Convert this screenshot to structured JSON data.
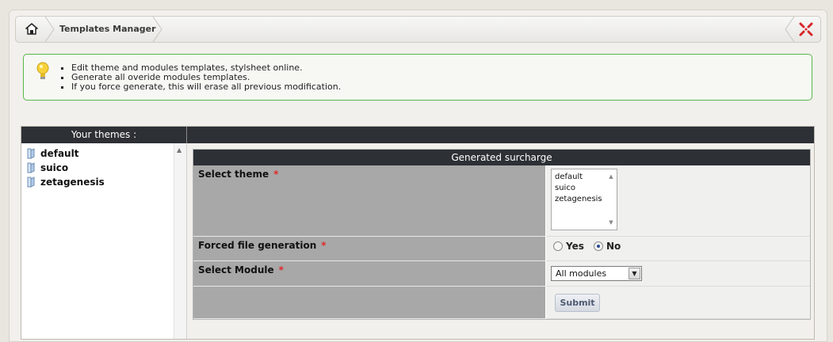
{
  "breadcrumb": {
    "title": "Templates Manager",
    "home_icon": "home-icon",
    "close_icon": "close-icon"
  },
  "tips": {
    "icon": "lightbulb-icon",
    "items": [
      "Edit theme and modules templates, stylsheet online.",
      "Generate all overide modules templates.",
      "If you force generate, this will erase all previous modification."
    ],
    "border_color": "#58b84a"
  },
  "themes_panel": {
    "header": "Your themes :",
    "items": [
      "default",
      "suico",
      "zetagenesis"
    ]
  },
  "form": {
    "title": "Generated surcharge",
    "select_theme_label": "Select theme",
    "theme_options": [
      "default",
      "suico",
      "zetagenesis"
    ],
    "forced_label": "Forced file generation",
    "yes_label": "Yes",
    "no_label": "No",
    "forced_selected": "No",
    "module_label": "Select Module",
    "module_value": "All modules",
    "required_mark": "*",
    "submit_label": "Submit"
  },
  "colors": {
    "header_dark": "#2d3035",
    "label_bg": "#a8a8a8",
    "required": "#e0282c"
  }
}
